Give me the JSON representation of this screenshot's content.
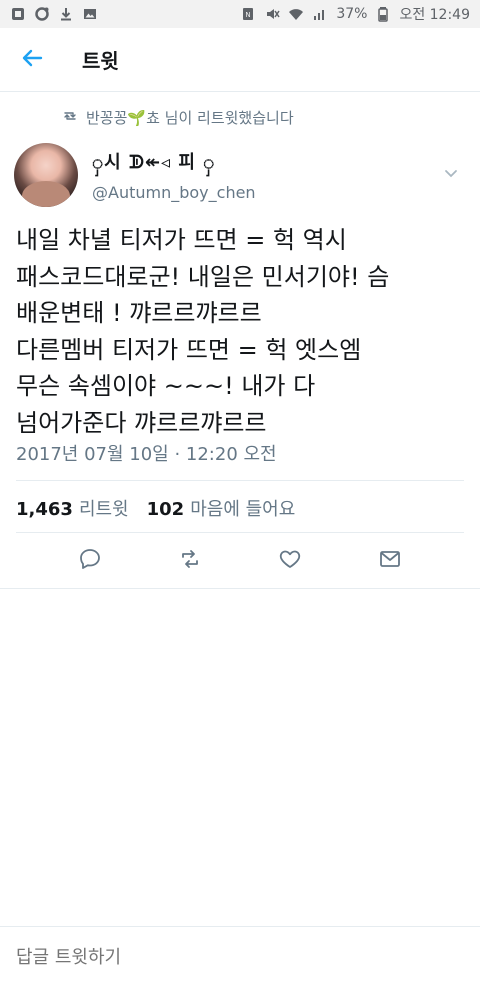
{
  "status_bar": {
    "battery": "37%",
    "time": "오전 12:49",
    "left_icons": [
      "app-icon",
      "notification-icon",
      "download-icon",
      "image-icon"
    ],
    "right_icons": [
      "nfc-icon",
      "mute-icon",
      "wifi-icon",
      "signal-icon",
      "battery-icon"
    ]
  },
  "header": {
    "title": "트윗",
    "back_icon": "back-arrow-icon"
  },
  "retweet_context": {
    "text": "반꽁꽁🌱쵸 님이 리트윗했습니다"
  },
  "author": {
    "display_name": "ှ시 ᗫ↞◃ 피 ှ",
    "handle": "@Autumn_boy_chen"
  },
  "tweet": {
    "lines": [
      "내일 차녈 티저가 뜨면 = 헉 역시",
      "패스코드대로군! 내일은 민서기야! 슴",
      "배운변태 ! 꺄르르꺄르르",
      "다른멤버 티저가 뜨면 = 헉 엣스엠",
      "무슨 속셈이야 ~~~! 내가 다",
      "넘어가준다 꺄르르꺄르르"
    ],
    "timestamp": "2017년 07월 10일 · 12:20 오전"
  },
  "stats": {
    "retweets_count": "1,463",
    "retweets_label": "리트윗",
    "likes_count": "102",
    "likes_label": "마음에 들어요"
  },
  "actions": [
    "reply-icon",
    "retweet-icon",
    "like-icon",
    "share-icon"
  ],
  "reply": {
    "placeholder": "답글 트윗하기"
  },
  "colors": {
    "accent": "#1da1f2",
    "secondary_text": "#657786",
    "divider": "#e6ecf0"
  }
}
